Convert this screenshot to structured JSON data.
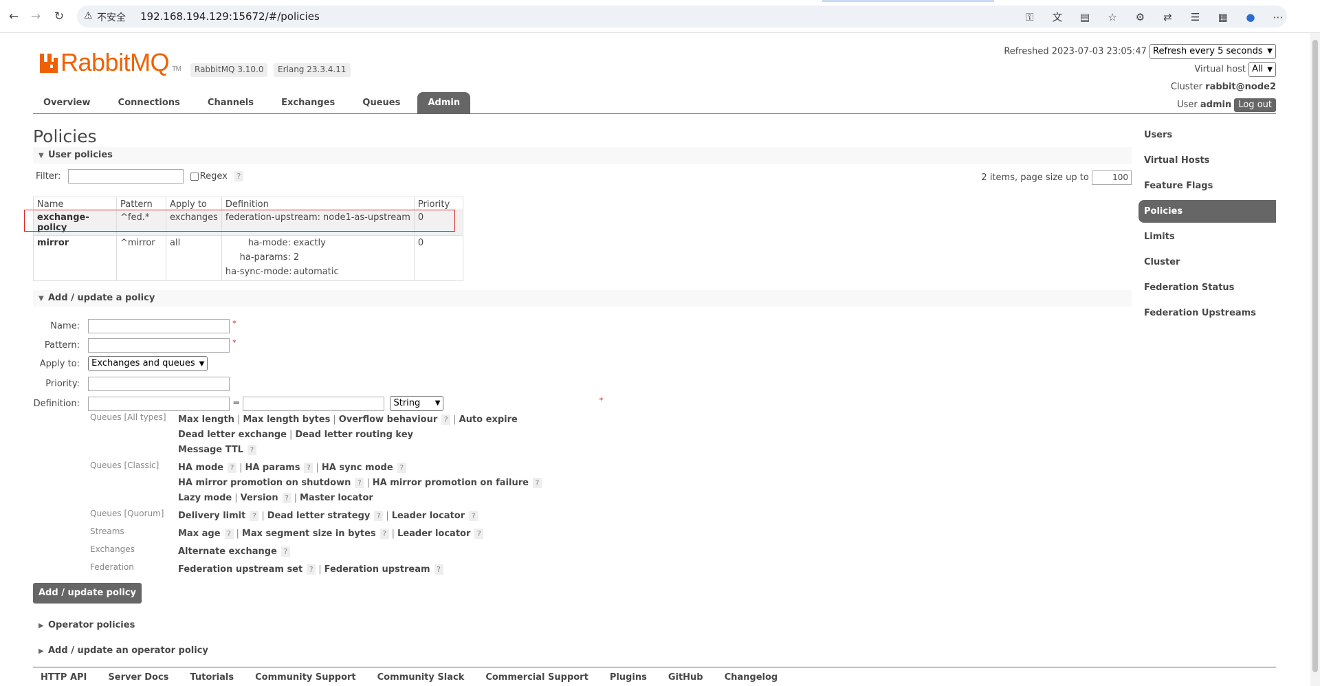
{
  "browser": {
    "insecure_label": "不安全",
    "url": "192.168.194.129:15672/#/policies"
  },
  "header": {
    "logo_text": "RabbitMQ",
    "tm": "TM",
    "rabbitmq_version": "RabbitMQ 3.10.0",
    "erlang_version": "Erlang 23.3.4.11",
    "refreshed_label": "Refreshed 2023-07-03 23:05:47",
    "refresh_select": "Refresh every 5 seconds",
    "vhost_label": "Virtual host",
    "vhost_select": "All",
    "cluster_label": "Cluster",
    "cluster_value": "rabbit@node2",
    "user_label": "User",
    "user_value": "admin",
    "logout": "Log out"
  },
  "tabs": [
    "Overview",
    "Connections",
    "Channels",
    "Exchanges",
    "Queues",
    "Admin"
  ],
  "page": {
    "title": "Policies",
    "user_policies": "User policies",
    "filter_label": "Filter:",
    "regex_label": "Regex",
    "help": "?",
    "paging_label": "2 items, page size up to",
    "page_size": "100"
  },
  "table": {
    "headers": [
      "Name",
      "Pattern",
      "Apply to",
      "Definition",
      "Priority"
    ],
    "rows": [
      {
        "name": "exchange-policy",
        "pattern": "^fed.*",
        "apply_to": "exchanges",
        "definition": [
          {
            "key": "federation-upstream:",
            "value": "node1-as-upstream"
          }
        ],
        "priority": "0"
      },
      {
        "name": "mirror",
        "pattern": "^mirror",
        "apply_to": "all",
        "definition": [
          {
            "key": "ha-mode:",
            "value": "exactly"
          },
          {
            "key": "ha-params:",
            "value": "2"
          },
          {
            "key": "ha-sync-mode:",
            "value": "automatic"
          }
        ],
        "priority": "0"
      }
    ]
  },
  "form": {
    "heading": "Add / update a policy",
    "name_label": "Name:",
    "pattern_label": "Pattern:",
    "apply_label": "Apply to:",
    "apply_value": "Exchanges and queues",
    "priority_label": "Priority:",
    "definition_label": "Definition:",
    "equals": "=",
    "type_value": "String",
    "required": "*",
    "groups": [
      {
        "label": "Queues [All types]",
        "lines": [
          [
            "Max length",
            "Max length bytes",
            "Overflow behaviour ?",
            "Auto expire"
          ],
          [
            "Dead letter exchange",
            "Dead letter routing key"
          ],
          [
            "Message TTL ?"
          ]
        ]
      },
      {
        "label": "Queues [Classic]",
        "lines": [
          [
            "HA mode ?",
            "HA params ?",
            "HA sync mode ?"
          ],
          [
            "HA mirror promotion on shutdown ?",
            "HA mirror promotion on failure ?"
          ],
          [
            "Lazy mode",
            "Version ?",
            "Master locator"
          ]
        ]
      },
      {
        "label": "Queues [Quorum]",
        "lines": [
          [
            "Delivery limit ?",
            "Dead letter strategy ?",
            "Leader locator ?"
          ]
        ]
      },
      {
        "label": "Streams",
        "lines": [
          [
            "Max age ?",
            "Max segment size in bytes ?",
            "Leader locator ?"
          ]
        ]
      },
      {
        "label": "Exchanges",
        "lines": [
          [
            "Alternate exchange ?"
          ]
        ]
      },
      {
        "label": "Federation",
        "lines": [
          [
            "Federation upstream set ?",
            "Federation upstream ?"
          ]
        ]
      }
    ],
    "submit": "Add / update policy"
  },
  "operator": {
    "operator_policies": "Operator policies",
    "add_operator_policy": "Add / update an operator policy"
  },
  "sidebar": [
    "Users",
    "Virtual Hosts",
    "Feature Flags",
    "Policies",
    "Limits",
    "Cluster",
    "Federation Status",
    "Federation Upstreams"
  ],
  "footer": [
    "HTTP API",
    "Server Docs",
    "Tutorials",
    "Community Support",
    "Community Slack",
    "Commercial Support",
    "Plugins",
    "GitHub",
    "Changelog"
  ],
  "colors": {
    "brand": "#f06000",
    "accent": "#666666",
    "highlight": "#e02020"
  }
}
